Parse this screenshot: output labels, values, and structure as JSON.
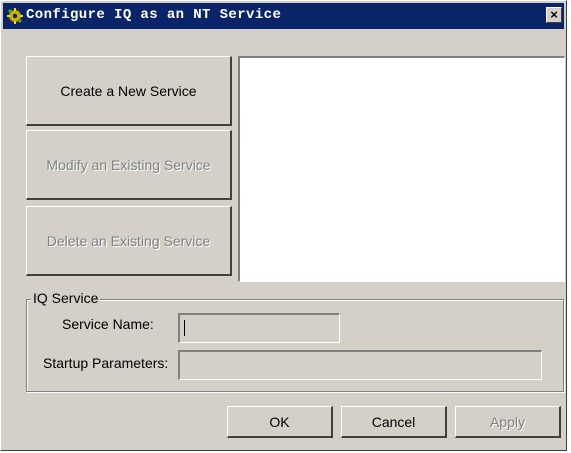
{
  "window": {
    "title": "Configure IQ as an NT Service",
    "close_glyph": "×",
    "app_icon": "network-service-icon",
    "colors": {
      "titlebar": "#0a246a",
      "face": "#d4d0c8"
    }
  },
  "actions": {
    "create_label": "Create a New Service",
    "modify_label": "Modify an Existing Service",
    "delete_label": "Delete an Existing Service",
    "modify_enabled": false,
    "delete_enabled": false
  },
  "service_list": {
    "items": []
  },
  "iq_service": {
    "group_label": "IQ Service",
    "service_name_label": "Service Name:",
    "service_name_value": "",
    "startup_params_label": "Startup Parameters:",
    "startup_params_value": ""
  },
  "footer": {
    "ok_label": "OK",
    "cancel_label": "Cancel",
    "apply_label": "Apply",
    "apply_enabled": false
  }
}
